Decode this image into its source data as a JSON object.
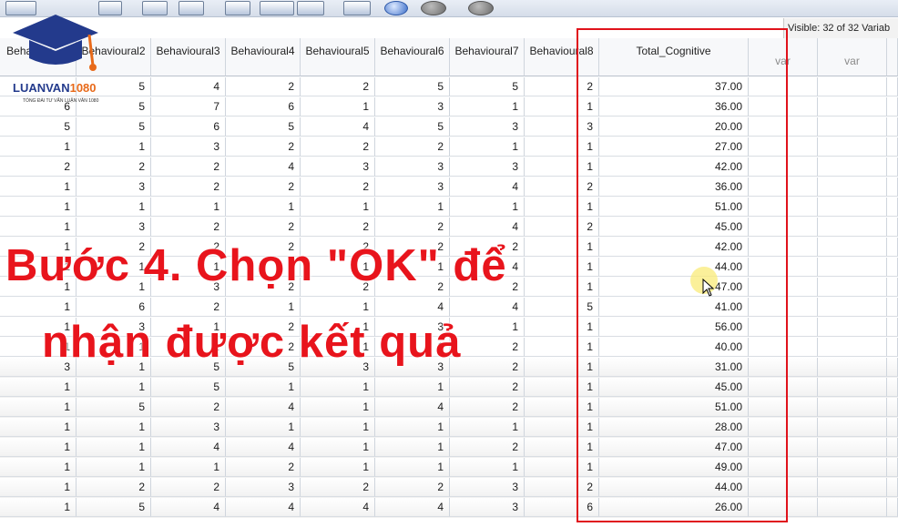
{
  "status": {
    "visible": "Visible: 32 of 32 Variab"
  },
  "columns": [
    "Behaviou…1",
    "Behavioural2",
    "Behavioural3",
    "Behavioural4",
    "Behavioural5",
    "Behavioural6",
    "Behavioural7",
    "Behavioural8",
    "Total_Cognitive",
    "var",
    "var"
  ],
  "rows": [
    [
      "",
      "5",
      "4",
      "2",
      "2",
      "5",
      "5",
      "2",
      "37.00"
    ],
    [
      "6",
      "5",
      "7",
      "6",
      "1",
      "3",
      "1",
      "1",
      "36.00"
    ],
    [
      "5",
      "5",
      "6",
      "5",
      "4",
      "5",
      "3",
      "3",
      "20.00"
    ],
    [
      "1",
      "1",
      "3",
      "2",
      "2",
      "2",
      "1",
      "1",
      "27.00"
    ],
    [
      "2",
      "2",
      "2",
      "4",
      "3",
      "3",
      "3",
      "1",
      "42.00"
    ],
    [
      "1",
      "3",
      "2",
      "2",
      "2",
      "3",
      "4",
      "2",
      "36.00"
    ],
    [
      "1",
      "1",
      "1",
      "1",
      "1",
      "1",
      "1",
      "1",
      "51.00"
    ],
    [
      "1",
      "3",
      "2",
      "2",
      "2",
      "2",
      "4",
      "2",
      "45.00"
    ],
    [
      "1",
      "2",
      "2",
      "2",
      "2",
      "2",
      "2",
      "1",
      "42.00"
    ],
    [
      "1",
      "1",
      "1",
      "1",
      "1",
      "1",
      "4",
      "1",
      "44.00"
    ],
    [
      "1",
      "1",
      "3",
      "2",
      "2",
      "2",
      "2",
      "1",
      "47.00"
    ],
    [
      "1",
      "6",
      "2",
      "1",
      "1",
      "4",
      "4",
      "5",
      "41.00"
    ],
    [
      "1",
      "3",
      "1",
      "2",
      "1",
      "3",
      "1",
      "1",
      "56.00"
    ],
    [
      "1",
      "1",
      "1",
      "2",
      "1",
      "1",
      "2",
      "1",
      "40.00"
    ],
    [
      "3",
      "1",
      "5",
      "5",
      "3",
      "3",
      "2",
      "1",
      "31.00"
    ],
    [
      "1",
      "1",
      "5",
      "1",
      "1",
      "1",
      "2",
      "1",
      "45.00"
    ],
    [
      "1",
      "5",
      "2",
      "4",
      "1",
      "4",
      "2",
      "1",
      "51.00"
    ],
    [
      "1",
      "1",
      "3",
      "1",
      "1",
      "1",
      "1",
      "1",
      "28.00"
    ],
    [
      "1",
      "1",
      "4",
      "4",
      "1",
      "1",
      "2",
      "1",
      "47.00"
    ],
    [
      "1",
      "1",
      "1",
      "2",
      "1",
      "1",
      "1",
      "1",
      "49.00"
    ],
    [
      "1",
      "2",
      "2",
      "3",
      "2",
      "2",
      "3",
      "2",
      "44.00"
    ],
    [
      "1",
      "5",
      "4",
      "4",
      "4",
      "4",
      "3",
      "6",
      "26.00"
    ]
  ],
  "overlay": {
    "line1": "Bước 4. Chọn \"OK\" để",
    "line2": "nhận được kết quả"
  },
  "logo": {
    "brand_a": "LUANVAN",
    "brand_b": "1080",
    "tagline": "TỔNG ĐÀI TƯ VẤN LUẬN VĂN 1080"
  },
  "colors": {
    "highlight": "#e0121b",
    "overlay_text": "#e8141c",
    "logo_blue": "#233a8c",
    "logo_orange": "#e86a1a"
  }
}
